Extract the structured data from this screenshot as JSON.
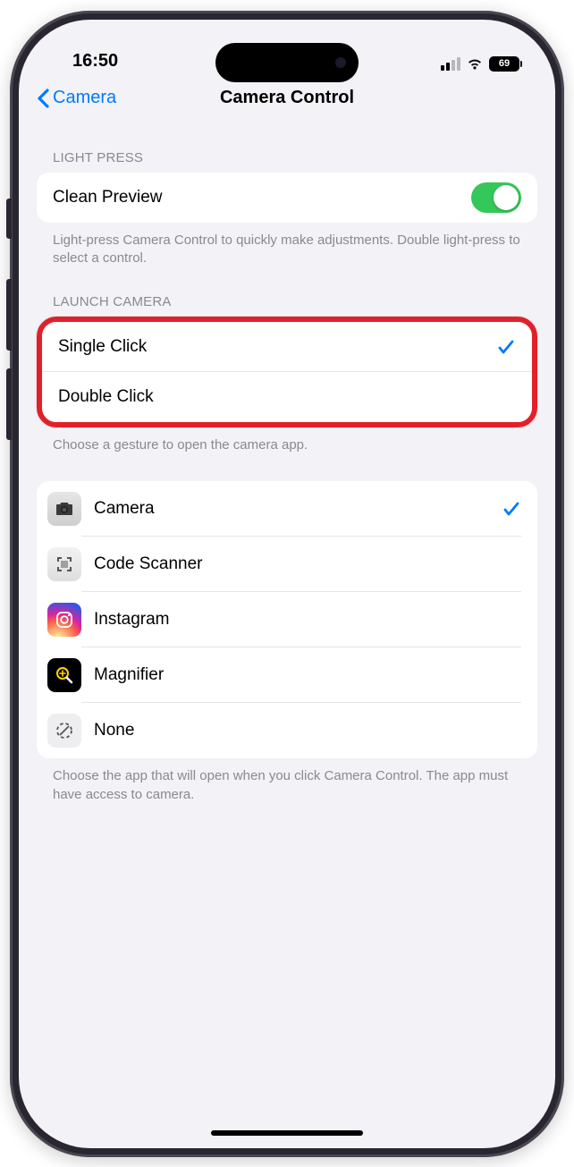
{
  "status": {
    "time": "16:50",
    "battery": "69"
  },
  "nav": {
    "back_label": "Camera",
    "title": "Camera Control"
  },
  "section_light_press": {
    "header": "LIGHT PRESS",
    "row_label": "Clean Preview",
    "toggle_on": true,
    "footer": "Light-press Camera Control to quickly make adjustments. Double light-press to select a control."
  },
  "section_launch": {
    "header": "LAUNCH CAMERA",
    "options": [
      {
        "label": "Single Click",
        "selected": true
      },
      {
        "label": "Double Click",
        "selected": false
      }
    ],
    "footer": "Choose a gesture to open the camera app."
  },
  "section_apps": {
    "items": [
      {
        "label": "Camera",
        "icon": "camera",
        "selected": true
      },
      {
        "label": "Code Scanner",
        "icon": "scanner",
        "selected": false
      },
      {
        "label": "Instagram",
        "icon": "instagram",
        "selected": false
      },
      {
        "label": "Magnifier",
        "icon": "magnifier",
        "selected": false
      },
      {
        "label": "None",
        "icon": "none",
        "selected": false
      }
    ],
    "footer": "Choose the app that will open when you click Camera Control. The app must have access to camera."
  }
}
